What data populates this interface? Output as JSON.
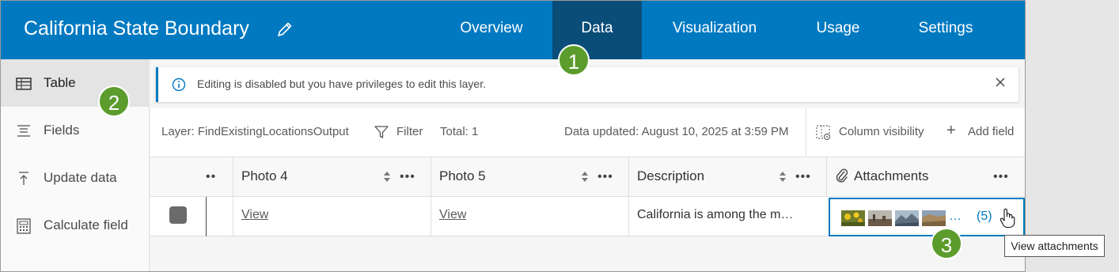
{
  "header": {
    "title": "California State Boundary",
    "tabs": [
      {
        "label": "Overview",
        "active": false
      },
      {
        "label": "Data",
        "active": true
      },
      {
        "label": "Visualization",
        "active": false
      },
      {
        "label": "Usage",
        "active": false
      },
      {
        "label": "Settings",
        "active": false
      }
    ],
    "bg_color": "#0079c1",
    "active_tab_color": "#0a4d78"
  },
  "sidebar": {
    "items": [
      {
        "label": "Table",
        "icon": "table-icon",
        "active": true
      },
      {
        "label": "Fields",
        "icon": "fields-icon",
        "active": false
      },
      {
        "label": "Update data",
        "icon": "upload-icon",
        "active": false
      },
      {
        "label": "Calculate field",
        "icon": "calculator-icon",
        "active": false
      }
    ]
  },
  "notice": {
    "text": "Editing is disabled but you have privileges to edit this layer.",
    "icon": "info-icon"
  },
  "toolbar": {
    "layer": "Layer: FindExistingLocationsOutput",
    "filter": "Filter",
    "total": "Total: 1",
    "updated": "Data updated: August 10, 2025 at 3:59 PM",
    "column_visibility": "Column visibility",
    "add_field": "Add field"
  },
  "table": {
    "columns": [
      "Photo 4",
      "Photo 5",
      "Description",
      "Attachments"
    ],
    "row": {
      "photo4": "View",
      "photo5": "View",
      "description": "California is among the m…",
      "attachments_ellipsis": "…",
      "attachments_count": "(5)"
    },
    "more": "•••",
    "more_short": "••"
  },
  "badges": [
    "1",
    "2",
    "3"
  ],
  "tooltip": "View attachments",
  "accent_color": "#0079c1",
  "badge_color": "#5b9c2c"
}
